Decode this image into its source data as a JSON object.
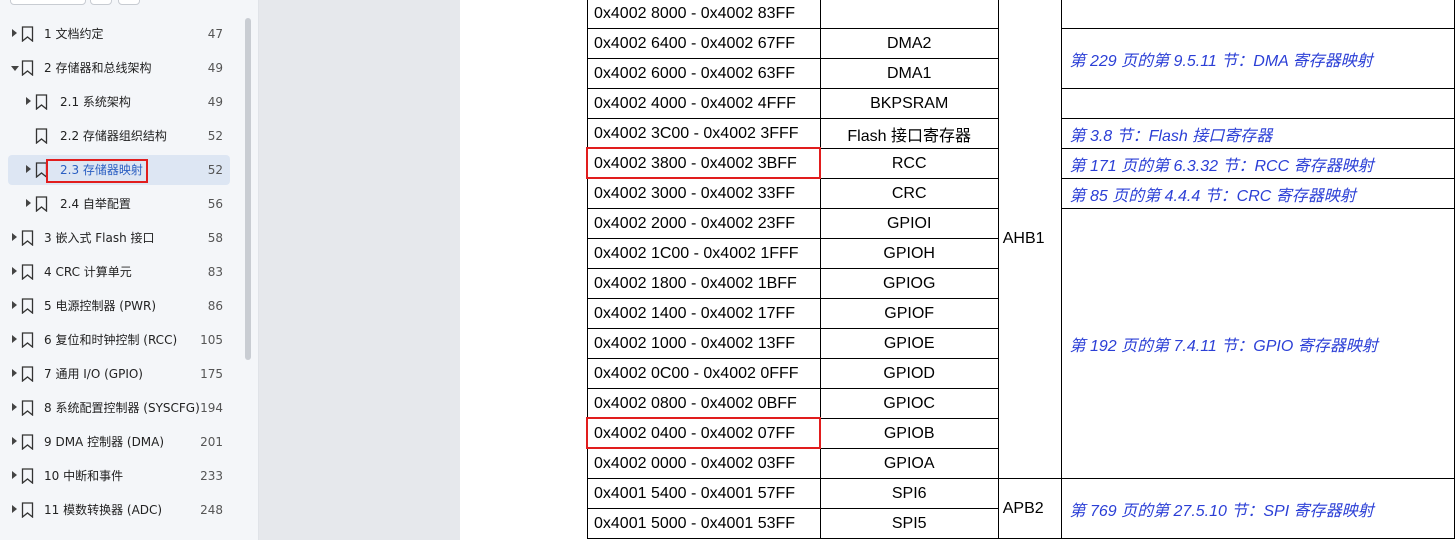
{
  "sidebar": {
    "items": [
      {
        "label": "1 文档约定",
        "page": "47",
        "level": 0,
        "expanded": false,
        "selected": false
      },
      {
        "label": "2 存储器和总线架构",
        "page": "49",
        "level": 0,
        "expanded": true,
        "selected": false
      },
      {
        "label": "2.1 系统架构",
        "page": "49",
        "level": 1,
        "expanded": false,
        "selected": false
      },
      {
        "label": "2.2 存储器组织结构",
        "page": "52",
        "level": 1,
        "expanded": null,
        "selected": false
      },
      {
        "label": "2.3 存储器映射",
        "page": "52",
        "level": 1,
        "expanded": false,
        "selected": true
      },
      {
        "label": "2.4 自举配置",
        "page": "56",
        "level": 1,
        "expanded": false,
        "selected": false
      },
      {
        "label": "3 嵌入式 Flash 接口",
        "page": "58",
        "level": 0,
        "expanded": false,
        "selected": false
      },
      {
        "label": "4 CRC 计算单元",
        "page": "83",
        "level": 0,
        "expanded": false,
        "selected": false
      },
      {
        "label": "5 电源控制器 (PWR)",
        "page": "86",
        "level": 0,
        "expanded": false,
        "selected": false
      },
      {
        "label": "6 复位和时钟控制 (RCC)",
        "page": "105",
        "level": 0,
        "expanded": false,
        "selected": false
      },
      {
        "label": "7 通用 I/O (GPIO)",
        "page": "175",
        "level": 0,
        "expanded": false,
        "selected": false
      },
      {
        "label": "8 系统配置控制器 (SYSCFG)",
        "page": "194",
        "level": 0,
        "expanded": false,
        "selected": false
      },
      {
        "label": "9 DMA 控制器 (DMA)",
        "page": "201",
        "level": 0,
        "expanded": false,
        "selected": false
      },
      {
        "label": "10 中断和事件",
        "page": "233",
        "level": 0,
        "expanded": false,
        "selected": false
      },
      {
        "label": "11 模数转换器 (ADC)",
        "page": "248",
        "level": 0,
        "expanded": false,
        "selected": false
      }
    ]
  },
  "table": {
    "rows": [
      {
        "range": "0x4002 8000 - 0x4002 83FF",
        "peripheral": ""
      },
      {
        "range": "0x4002 6400 - 0x4002 67FF",
        "peripheral": "DMA2"
      },
      {
        "range": "0x4002 6000 - 0x4002 63FF",
        "peripheral": "DMA1"
      },
      {
        "range": "0x4002 4000 - 0x4002 4FFF",
        "peripheral": "BKPSRAM"
      },
      {
        "range": "0x4002 3C00 - 0x4002 3FFF",
        "peripheral": "Flash 接口寄存器"
      },
      {
        "range": "0x4002 3800 - 0x4002 3BFF",
        "peripheral": "RCC"
      },
      {
        "range": "0x4002 3000 - 0x4002 33FF",
        "peripheral": "CRC"
      },
      {
        "range": "0x4002 2000 - 0x4002 23FF",
        "peripheral": "GPIOI"
      },
      {
        "range": "0x4002 1C00 - 0x4002 1FFF",
        "peripheral": "GPIOH"
      },
      {
        "range": "0x4002 1800 - 0x4002 1BFF",
        "peripheral": "GPIOG"
      },
      {
        "range": "0x4002 1400 - 0x4002 17FF",
        "peripheral": "GPIOF"
      },
      {
        "range": "0x4002 1000 - 0x4002 13FF",
        "peripheral": "GPIOE"
      },
      {
        "range": "0x4002 0C00 - 0x4002 0FFF",
        "peripheral": "GPIOD"
      },
      {
        "range": "0x4002 0800 - 0x4002 0BFF",
        "peripheral": "GPIOC"
      },
      {
        "range": "0x4002 0400 - 0x4002 07FF",
        "peripheral": "GPIOB"
      },
      {
        "range": "0x4002 0000 - 0x4002 03FF",
        "peripheral": "GPIOA"
      },
      {
        "range": "0x4001 5400 - 0x4001 57FF",
        "peripheral": "SPI6"
      },
      {
        "range": "0x4001 5000 - 0x4001 53FF",
        "peripheral": "SPI5"
      }
    ],
    "bus_groups": [
      {
        "label": "AHB1",
        "start": 0,
        "span": 16
      },
      {
        "label": "APB2",
        "start": 16,
        "span": 2
      }
    ],
    "ref_groups": [
      {
        "text": "",
        "start": 0,
        "span": 1
      },
      {
        "text": "第 229 页的第 9.5.11 节：DMA 寄存器映射",
        "start": 1,
        "span": 2
      },
      {
        "text": "",
        "start": 3,
        "span": 1
      },
      {
        "text": "第 3.8 节：Flash 接口寄存器",
        "start": 4,
        "span": 1
      },
      {
        "text": "第 171 页的第 6.3.32 节：RCC 寄存器映射",
        "start": 5,
        "span": 1
      },
      {
        "text": "第 85 页的第 4.4.4 节：CRC 寄存器映射",
        "start": 6,
        "span": 1
      },
      {
        "text": "第 192 页的第 7.4.11 节：GPIO 寄存器映射",
        "start": 7,
        "span": 9
      },
      {
        "text": "第 769 页的第 27.5.10 节：SPI 寄存器映射",
        "start": 16,
        "span": 2
      }
    ],
    "highlighted_rows": [
      5,
      14
    ]
  },
  "colors": {
    "link": "#2b3fd6",
    "highlight": "#e11d1d",
    "selected_bg": "#dde6f3"
  }
}
